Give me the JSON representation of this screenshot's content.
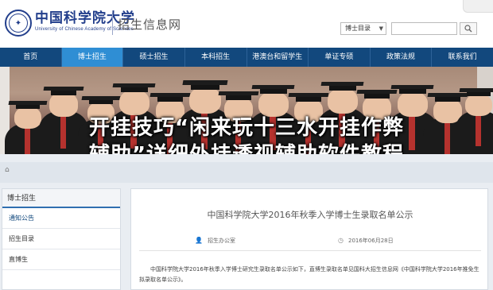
{
  "header": {
    "logo_cn": "中国科学院大学",
    "logo_en": "University of Chinese Academy of Sciences",
    "site_name": "招生信息网",
    "search_select_value": "博士目录",
    "search_placeholder": ""
  },
  "nav": {
    "items": [
      {
        "label": "首页"
      },
      {
        "label": "博士招生"
      },
      {
        "label": "硕士招生"
      },
      {
        "label": "本科招生"
      },
      {
        "label": "港澳台和留学生"
      },
      {
        "label": "单证专硕"
      },
      {
        "label": "政策法规"
      },
      {
        "label": "联系我们"
      }
    ],
    "active_index": 1
  },
  "overlay": {
    "line1": "开挂技巧“闲来玩十三水开挂作弊",
    "line2": "辅助”详细外挂透视辅助软件教程"
  },
  "sidebar": {
    "title": "博士招生",
    "items": [
      {
        "label": "通知公告"
      },
      {
        "label": "招生目录"
      },
      {
        "label": "直博生"
      }
    ]
  },
  "article": {
    "title": "中国科学院大学2016年秋季入学博士生录取名单公示",
    "author": "招生办公室",
    "date": "2016年06月28日",
    "body": "中国科学院大学2016年秋季入学博士研究生录取名单公示如下，直博生录取名单见国科大招生信息网《中国科学院大学2016年推免生拟录取名单公示》。"
  },
  "icons": {
    "search": "search-icon",
    "dropdown": "chevron-down-icon",
    "person": "person-icon",
    "clock": "clock-icon",
    "home": "home-icon"
  },
  "colors": {
    "nav_bg": "#12487d",
    "nav_active": "#2f8ed4",
    "brand": "#233f8c"
  }
}
